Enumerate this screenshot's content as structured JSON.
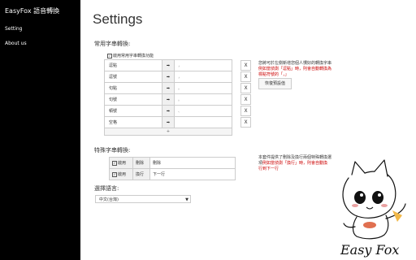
{
  "sidebar": {
    "brand": "EasyFox 語音轉換",
    "items": [
      {
        "label": "Setting"
      },
      {
        "label": "About us"
      }
    ]
  },
  "main": {
    "title": "Settings",
    "common": {
      "heading": "常用字串轉換:",
      "enable_label": "啟用常用字串轉換功能",
      "arrow_icon": "arrow-right-icon",
      "rows": [
        {
          "from": "逗點",
          "to": "，"
        },
        {
          "from": "逗號",
          "to": "，"
        },
        {
          "from": "句點",
          "to": "。"
        },
        {
          "from": "句號",
          "to": "。"
        },
        {
          "from": "頓號",
          "to": "、"
        },
        {
          "from": "空格",
          "to": ""
        }
      ],
      "delete_label": "X",
      "add_label": "+",
      "note_text": "您將可於左側新增您個人慣好的轉換字串",
      "note_red": "例如當偵測「逗點」時，則會自動轉換為標點符號的「，」",
      "reset_label": "恢復預設值"
    },
    "special": {
      "heading": "特殊字串轉換:",
      "rows": [
        {
          "enable": "啟用",
          "action": "刪除",
          "desc": "刪除"
        },
        {
          "enable": "啟用",
          "action": "換行",
          "desc": "下一行"
        }
      ],
      "note_text": "本套件提供了刪除及換行兩個特殊轉換選項",
      "note_red": "例如當偵測「換行」時，則會自動換行到下一行"
    },
    "language": {
      "heading": "選擇語言:",
      "selected": "中文(台灣)"
    }
  },
  "mascot": {
    "signature": "Easy Fox"
  }
}
